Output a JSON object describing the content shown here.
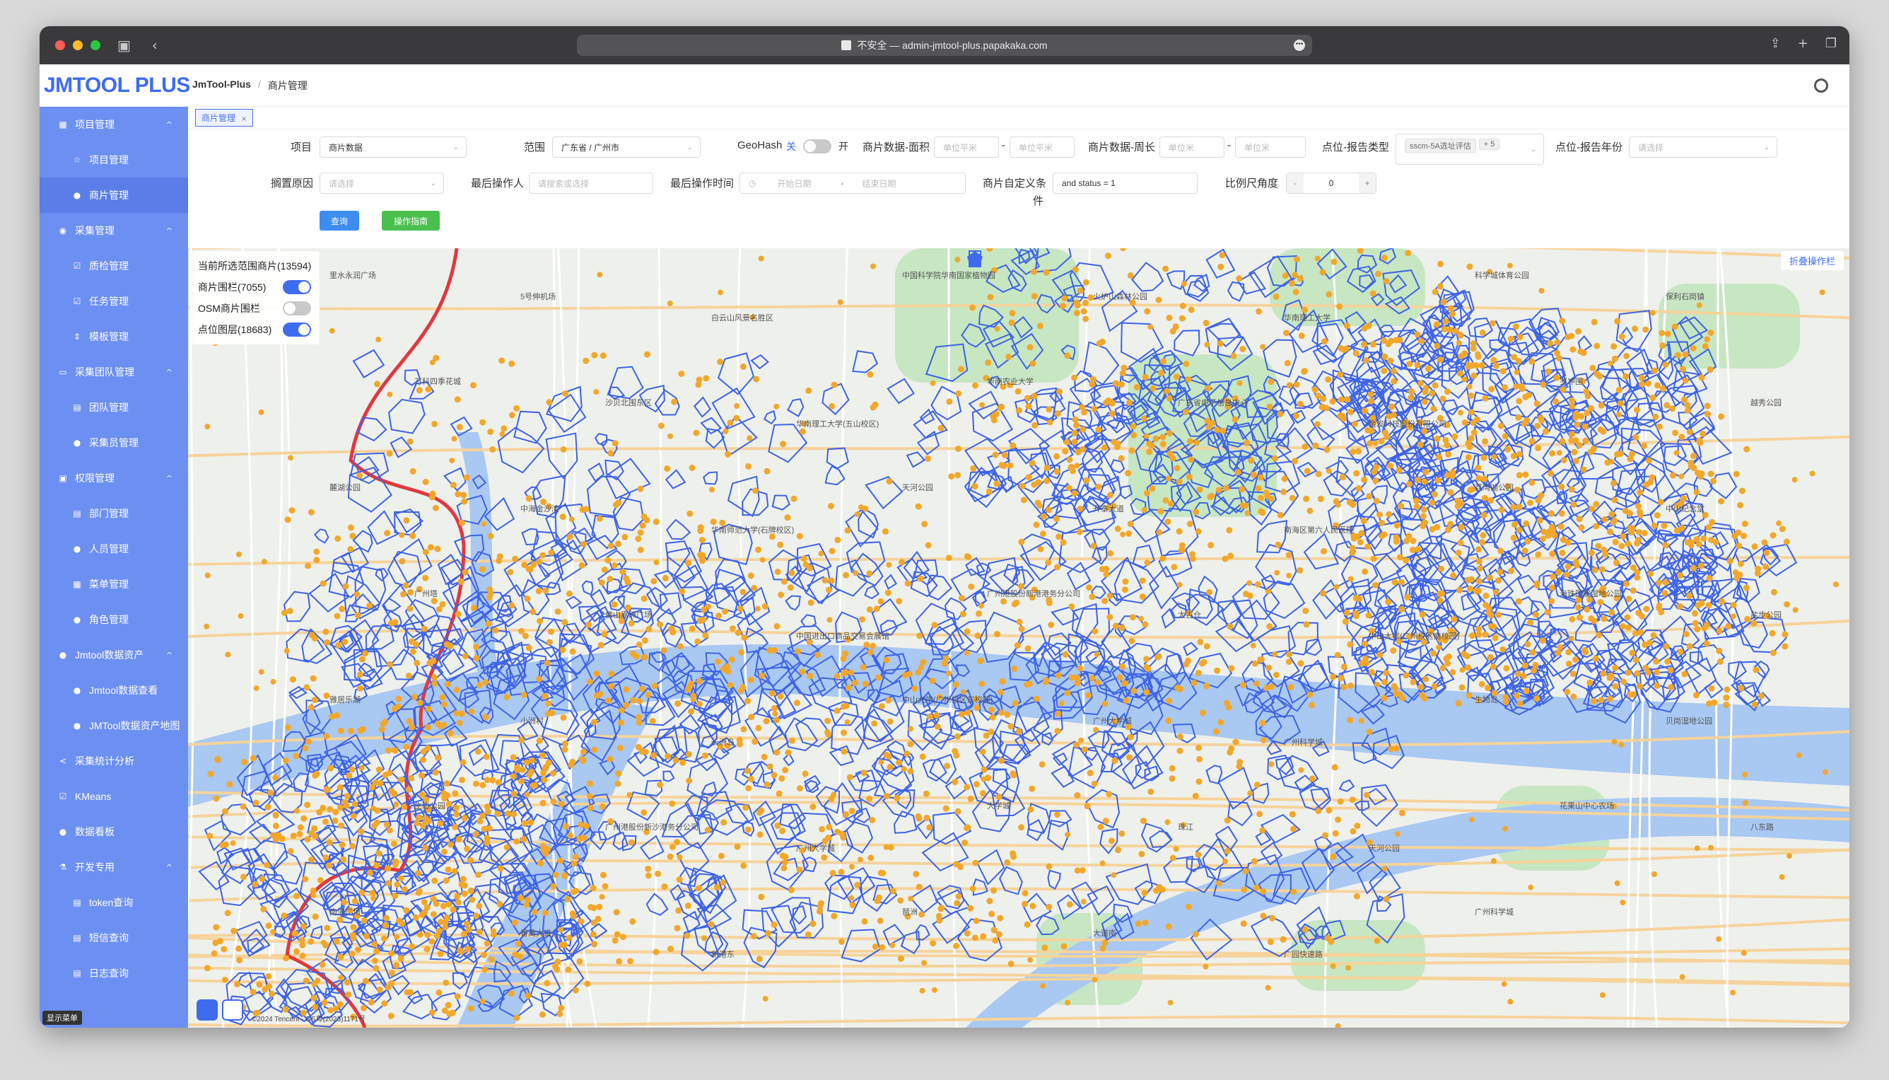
{
  "browser": {
    "url": "不安全 — admin-jmtool-plus.papakaka.com"
  },
  "header": {
    "logo": "JMTOOL PLUS",
    "breadcrumb": [
      "JmTool-Plus",
      "/",
      "商片管理"
    ]
  },
  "sidebar": {
    "items": [
      {
        "label": "项目管理",
        "level": "top",
        "icon": "grid-icon",
        "chevron": "^"
      },
      {
        "label": "项目管理",
        "level": "sub",
        "icon": "star-icon"
      },
      {
        "label": "商片管理",
        "level": "sub",
        "icon": "user-icon",
        "active": true
      },
      {
        "label": "采集管理",
        "level": "top",
        "icon": "pin-icon",
        "chevron": "^"
      },
      {
        "label": "质检管理",
        "level": "sub",
        "icon": "check-icon"
      },
      {
        "label": "任务管理",
        "level": "sub",
        "icon": "check-icon"
      },
      {
        "label": "模板管理",
        "level": "sub",
        "icon": "sort-icon"
      },
      {
        "label": "采集团队管理",
        "level": "top",
        "icon": "monitor-icon",
        "chevron": "^"
      },
      {
        "label": "团队管理",
        "level": "sub",
        "icon": "chat-icon"
      },
      {
        "label": "采集员管理",
        "level": "sub",
        "icon": "user-icon"
      },
      {
        "label": "权限管理",
        "level": "top",
        "icon": "lock-icon",
        "chevron": "^"
      },
      {
        "label": "部门管理",
        "level": "sub",
        "icon": "chat-icon"
      },
      {
        "label": "人员管理",
        "level": "sub",
        "icon": "user-icon"
      },
      {
        "label": "菜单管理",
        "level": "sub",
        "icon": "grid-icon"
      },
      {
        "label": "角色管理",
        "level": "sub",
        "icon": "user-icon"
      },
      {
        "label": "Jmtool数据资产",
        "level": "top",
        "icon": "user-icon",
        "chevron": "^"
      },
      {
        "label": "Jmtool数据查看",
        "level": "sub",
        "icon": "user-icon"
      },
      {
        "label": "JMTool数据资产地图",
        "level": "sub",
        "icon": "user-icon"
      },
      {
        "label": "采集统计分析",
        "level": "top",
        "icon": "share-icon"
      },
      {
        "label": "KMeans",
        "level": "top",
        "icon": "check-icon"
      },
      {
        "label": "数据看板",
        "level": "top",
        "icon": "user-icon"
      },
      {
        "label": "开发专用",
        "level": "top",
        "icon": "flask-icon",
        "chevron": "^"
      },
      {
        "label": "token查询",
        "level": "sub",
        "icon": "doc-icon"
      },
      {
        "label": "短信查询",
        "level": "sub",
        "icon": "chat-icon"
      },
      {
        "label": "日志查询",
        "level": "sub",
        "icon": "doc-icon"
      }
    ],
    "tooltip": "显示菜单"
  },
  "tabs": [
    {
      "label": "商片管理",
      "close": "×"
    }
  ],
  "filters": {
    "project_label": "项目",
    "project_value": "商片数据",
    "scope_label": "范围",
    "scope_value": "广东省 / 广州市",
    "geohash_label": "GeoHash",
    "geohash_off": "关",
    "geohash_on": "开",
    "area_label": "商片数据-面积",
    "area_min_ph": "单位平米",
    "area_dash": "-",
    "area_max_ph": "单位平米",
    "perim_label": "商片数据-周长",
    "perim_min_ph": "单位米",
    "perim_dash": "-",
    "perim_max_ph": "单位米",
    "report_type_label": "点位-报告类型",
    "report_type_tag": "sscm-5A选址评估",
    "report_type_more": "+ 5",
    "report_year_label": "点位-报告年份",
    "report_year_ph": "请选择",
    "shelve_label": "搁置原因",
    "shelve_ph": "请选择",
    "operator_label": "最后操作人",
    "operator_ph": "请搜索或选择",
    "optime_label": "最后操作时间",
    "optime_start_ph": "开始日期",
    "optime_sep": "-",
    "optime_end_ph": "结束日期",
    "custom_label": "商片自定义条",
    "custom_label2": "件",
    "custom_value": "and status = 1",
    "scale_label": "比例尺角度",
    "scale_minus": "-",
    "scale_value": "0",
    "scale_plus": "+",
    "query_btn": "查询",
    "guide_btn": "操作指南"
  },
  "map": {
    "panel_title": "当前所选范围商片(13594)",
    "layers": [
      {
        "label": "商片围栏(7055)",
        "on": true
      },
      {
        "label": "OSM商片围栏",
        "on": false
      },
      {
        "label": "点位图层(18683)",
        "on": true
      }
    ],
    "collapse_label": "折叠操作栏",
    "copyright": "©2024 Tencent - GS粤(2023)1171号",
    "labels": [
      "里水永润广场",
      "5号伸机场",
      "白云山风景名胜区",
      "中国科学院华南国家植物园",
      "火炉山森林公园",
      "华南理工大学",
      "科学城体育公园",
      "保利石岗镇",
      "万科四季花城",
      "沙贝北围东区",
      "华南理工大学(五山校区)",
      "华南农业大学",
      "广东省电子信息中心",
      "金发科技股份有限公司",
      "罗冲围",
      "越秀公园",
      "麓湖公园",
      "中海金沙湾",
      "华南师范大学(石牌校区)",
      "天河公园",
      "开泰大道",
      "南海区第六人民医院",
      "荔湾湖公园",
      "中山纪念堂",
      "广州塔",
      "佛山嘉洲广场",
      "中国进出口商品交易会展馆",
      "广州港股份新港港务分公司",
      "太古仓",
      "中山大学(广州校区南校园)",
      "海珠国家湿地公园",
      "盐步公园",
      "雅居乐湖",
      "小洲村",
      "长洲岛",
      "中山大学(广州校区东校园)",
      "广州大学城",
      "广州科学城",
      "生物岛",
      "贝岗湿地公园",
      "生态公园",
      "广州港股份新沙港务分公司",
      "广州大学城",
      "大学城",
      "珠江",
      "天河公园",
      "花果山中心农场",
      "八东路",
      "南海广场",
      "番禺大道",
      "新港东",
      "琶洲",
      "大道南",
      "广园快速路",
      "广州科学城"
    ]
  },
  "colors": {
    "brand": "#3e6bf0",
    "sidebar": "#6c8ff2",
    "fence": "#3d63e6",
    "point": "#f2a72a",
    "water": "#a9c8f2",
    "green": "#c7e6c2",
    "boundary": "#e0393e",
    "guide_btn": "#4bbf4e",
    "query_btn": "#3e8cf0"
  }
}
